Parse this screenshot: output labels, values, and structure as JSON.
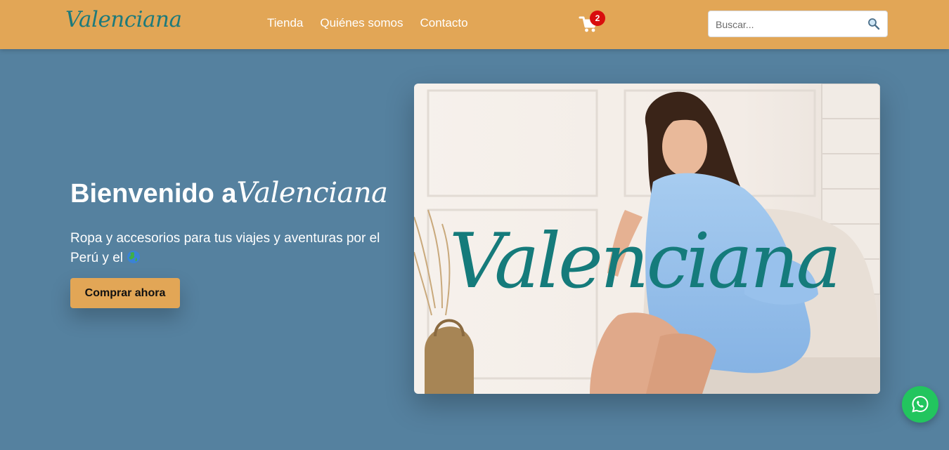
{
  "header": {
    "logo": "Valenciana",
    "nav": [
      "Tienda",
      "Quiénes somos",
      "Contacto"
    ],
    "cart_count": "2",
    "search_placeholder": "Buscar..."
  },
  "hero": {
    "title_prefix": "Bienvenido a",
    "title_brand": "Valenciana",
    "subtitle": "Ropa y accesorios para tus viajes y aventuras por el Perú y el",
    "subtitle_emoji": "globe-icon",
    "cta_label": "Comprar ahora",
    "image_brand_text": "Valenciana"
  },
  "icons": {
    "cart": "cart-icon",
    "search": "search-icon",
    "whatsapp": "whatsapp-icon"
  },
  "colors": {
    "header_bg": "#e2a656",
    "page_bg": "#55819f",
    "brand_teal": "#1d7a7b",
    "badge_red": "#d90d0d",
    "whatsapp_green": "#22c55e"
  }
}
